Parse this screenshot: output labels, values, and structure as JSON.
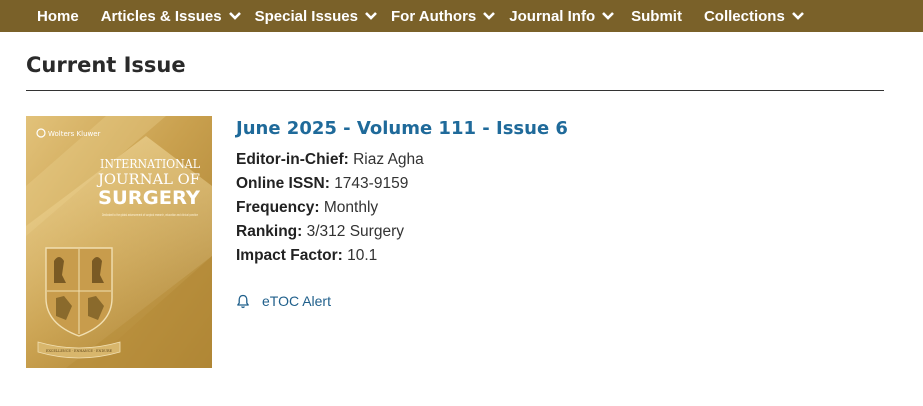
{
  "nav": {
    "items": [
      {
        "label": "Home",
        "dropdown": false
      },
      {
        "label": "Articles & Issues",
        "dropdown": true
      },
      {
        "label": "Special Issues",
        "dropdown": true
      },
      {
        "label": "For Authors",
        "dropdown": true
      },
      {
        "label": "Journal Info",
        "dropdown": true
      },
      {
        "label": "Submit",
        "dropdown": false
      },
      {
        "label": "Collections",
        "dropdown": true
      }
    ],
    "background": "#7a6129"
  },
  "page": {
    "title": "Current Issue"
  },
  "cover": {
    "publisher": "Wolters Kluwer",
    "journal_line1": "INTERNATIONAL",
    "journal_line2": "JOURNAL OF",
    "journal_line3": "SURGERY",
    "tagline": "Dedicated to the global advancement of surgical research, education and clinical practice",
    "motto": "EXCELLENCE · ENHANCE · ENDURE"
  },
  "issue": {
    "title": "June 2025 - Volume 111 - Issue 6",
    "editor_label": "Editor-in-Chief:",
    "editor_value": "Riaz Agha",
    "issn_label": "Online ISSN:",
    "issn_value": "1743-9159",
    "frequency_label": "Frequency:",
    "frequency_value": "Monthly",
    "ranking_label": "Ranking:",
    "ranking_value": "3/312 Surgery",
    "impact_label": "Impact Factor:",
    "impact_value": "10.1"
  },
  "etoc": {
    "label": "eTOC Alert",
    "icon": "bell-icon"
  }
}
